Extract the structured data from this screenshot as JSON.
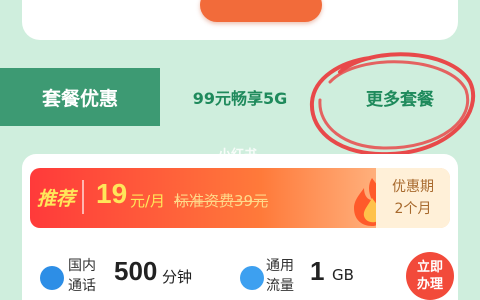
{
  "tabs": [
    {
      "label": "套餐优惠"
    },
    {
      "label": "99元畅享5G"
    },
    {
      "label": "更多套餐"
    }
  ],
  "watermark": "小红书",
  "plan": {
    "tag": "推荐",
    "price": "19",
    "price_unit": "元/月",
    "standard_fee": "标准资费39元",
    "promo_line1": "优惠期",
    "promo_line2": "2个月",
    "calls_label_1": "国内",
    "calls_label_2": "通话",
    "calls_value": "500",
    "calls_unit": "分钟",
    "data_label_1": "通用",
    "data_label_2": "流量",
    "data_value": "1",
    "data_unit": "GB",
    "apply_line1": "立即",
    "apply_line2": "办理"
  },
  "colors": {
    "background": "#cfeedd",
    "tab_active": "#3d9a73",
    "tab_text": "#1f8a5c",
    "accent_red": "#f24a3a",
    "price_yellow": "#ffe65a"
  },
  "icons": [
    "phone-icon",
    "droplet-icon",
    "flame-icon"
  ]
}
